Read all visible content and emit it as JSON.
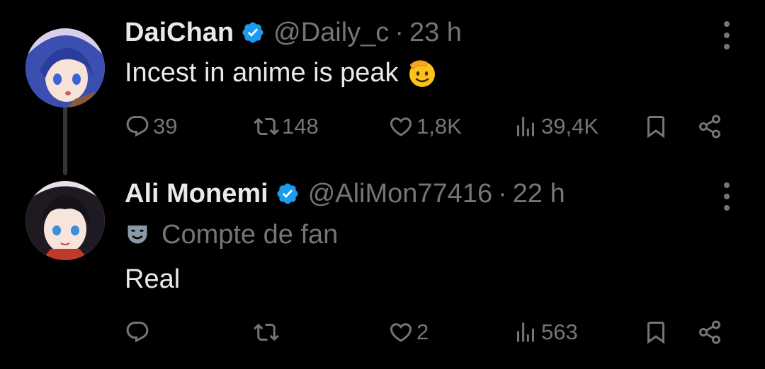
{
  "tweets": [
    {
      "author_name": "DaiChan",
      "handle": "@Daily_c",
      "separator": "·",
      "time": "23 h",
      "text": "Incest in anime is peak",
      "emoji": "saluting-face-emoji",
      "counts": {
        "replies": "39",
        "retweets": "148",
        "likes": "1,8K",
        "views": "39,4K"
      }
    },
    {
      "author_name": "Ali Monemi",
      "handle": "@AliMon77416",
      "separator": "·",
      "time": "22 h",
      "fan_label": "Compte de fan",
      "text": "Real",
      "counts": {
        "replies": "",
        "retweets": "",
        "likes": "2",
        "views": "563"
      }
    }
  ],
  "colors": {
    "background": "#000000",
    "text_primary": "#e7e9ea",
    "text_secondary": "#71767b",
    "verified_blue": "#1d9bf0",
    "thread_line": "#333639"
  },
  "icons": [
    "verified-badge-icon",
    "more-options-icon",
    "reply-icon",
    "retweet-icon",
    "like-icon",
    "views-icon",
    "bookmark-icon",
    "share-icon",
    "theater-mask-icon"
  ]
}
